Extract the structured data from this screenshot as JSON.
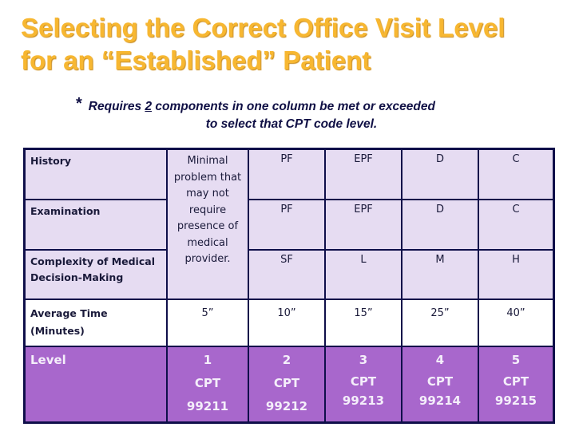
{
  "title": {
    "line1": "Selecting the Correct Office Visit Level",
    "line2": "for an “Established” Patient"
  },
  "note": {
    "star": "*",
    "prefix": "Requires ",
    "emphasis": "2",
    "suffix": " components in one column be met or exceeded",
    "line2": "to select that CPT code level."
  },
  "table": {
    "rows": {
      "history": {
        "label": "History",
        "values": [
          "PF",
          "EPF",
          "D",
          "C"
        ]
      },
      "examination": {
        "label": "Examination",
        "values": [
          "PF",
          "EPF",
          "D",
          "C"
        ]
      },
      "complexity": {
        "label": "Complexity of Medical Decision-Making",
        "values": [
          "SF",
          "L",
          "M",
          "H"
        ]
      },
      "time": {
        "label": "Average Time (Minutes)",
        "values": [
          "5”",
          "10”",
          "15”",
          "25”",
          "40”"
        ]
      },
      "level": {
        "label": "Level",
        "numbers": [
          "1",
          "2",
          "3",
          "4",
          "5"
        ],
        "codes": [
          "CPT 99211",
          "CPT 99212",
          "CPT 99213",
          "CPT 99214",
          "CPT 99215"
        ]
      }
    },
    "level1_description": "Minimal problem that may not require presence of medical provider."
  },
  "colors": {
    "title": "#f7b731",
    "note": "#101045",
    "border": "#0f0f4a",
    "lavender": "#e6dcf2",
    "level_purple": "#a867cc"
  }
}
